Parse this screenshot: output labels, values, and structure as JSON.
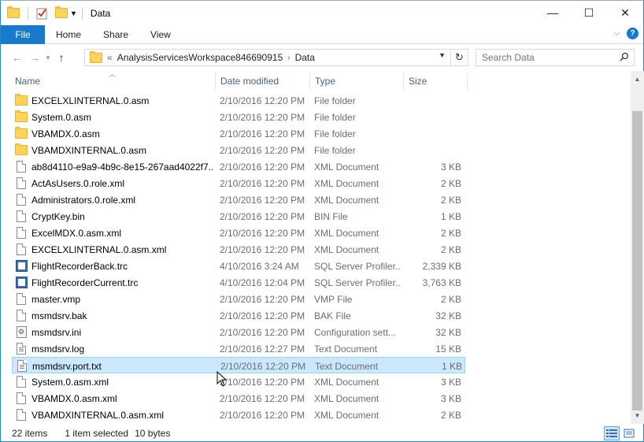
{
  "window": {
    "title": "Data",
    "controls": {
      "minimize": "—",
      "maximize": "☐",
      "close": "✕"
    }
  },
  "ribbon": {
    "tabs": [
      "File",
      "Home",
      "Share",
      "View"
    ]
  },
  "address": {
    "overflow": "«",
    "crumbs": [
      "AnalysisServicesWorkspace846690915",
      "Data"
    ]
  },
  "search": {
    "placeholder": "Search Data"
  },
  "columns": {
    "name": "Name",
    "date": "Date modified",
    "type": "Type",
    "size": "Size"
  },
  "files": [
    {
      "icon": "folder-icon",
      "name": "EXCELXLINTERNAL.0.asm",
      "date": "2/10/2016 12:20 PM",
      "type": "File folder",
      "size": ""
    },
    {
      "icon": "folder-icon",
      "name": "System.0.asm",
      "date": "2/10/2016 12:20 PM",
      "type": "File folder",
      "size": ""
    },
    {
      "icon": "folder-icon",
      "name": "VBAMDX.0.asm",
      "date": "2/10/2016 12:20 PM",
      "type": "File folder",
      "size": ""
    },
    {
      "icon": "folder-icon",
      "name": "VBAMDXINTERNAL.0.asm",
      "date": "2/10/2016 12:20 PM",
      "type": "File folder",
      "size": ""
    },
    {
      "icon": "document-icon",
      "name": "ab8d4110-e9a9-4b9c-8e15-267aad4022f7....",
      "date": "2/10/2016 12:20 PM",
      "type": "XML Document",
      "size": "3 KB"
    },
    {
      "icon": "document-icon",
      "name": "ActAsUsers.0.role.xml",
      "date": "2/10/2016 12:20 PM",
      "type": "XML Document",
      "size": "2 KB"
    },
    {
      "icon": "document-icon",
      "name": "Administrators.0.role.xml",
      "date": "2/10/2016 12:20 PM",
      "type": "XML Document",
      "size": "2 KB"
    },
    {
      "icon": "document-icon",
      "name": "CryptKey.bin",
      "date": "2/10/2016 12:20 PM",
      "type": "BIN File",
      "size": "1 KB"
    },
    {
      "icon": "document-icon",
      "name": "ExcelMDX.0.asm.xml",
      "date": "2/10/2016 12:20 PM",
      "type": "XML Document",
      "size": "2 KB"
    },
    {
      "icon": "document-icon",
      "name": "EXCELXLINTERNAL.0.asm.xml",
      "date": "2/10/2016 12:20 PM",
      "type": "XML Document",
      "size": "2 KB"
    },
    {
      "icon": "trace-file-icon",
      "name": "FlightRecorderBack.trc",
      "date": "4/10/2016 3:24 AM",
      "type": "SQL Server Profiler...",
      "size": "2,339 KB"
    },
    {
      "icon": "trace-file-icon",
      "name": "FlightRecorderCurrent.trc",
      "date": "4/10/2016 12:04 PM",
      "type": "SQL Server Profiler...",
      "size": "3,763 KB"
    },
    {
      "icon": "document-icon",
      "name": "master.vmp",
      "date": "2/10/2016 12:20 PM",
      "type": "VMP File",
      "size": "2 KB"
    },
    {
      "icon": "document-icon",
      "name": "msmdsrv.bak",
      "date": "2/10/2016 12:20 PM",
      "type": "BAK File",
      "size": "32 KB"
    },
    {
      "icon": "settings-file-icon",
      "name": "msmdsrv.ini",
      "date": "2/10/2016 12:20 PM",
      "type": "Configuration sett...",
      "size": "32 KB"
    },
    {
      "icon": "text-file-icon",
      "name": "msmdsrv.log",
      "date": "2/10/2016 12:27 PM",
      "type": "Text Document",
      "size": "15 KB"
    },
    {
      "icon": "text-file-icon",
      "name": "msmdsrv.port.txt",
      "date": "2/10/2016 12:20 PM",
      "type": "Text Document",
      "size": "1 KB",
      "selected": true
    },
    {
      "icon": "document-icon",
      "name": "System.0.asm.xml",
      "date": "2/10/2016 12:20 PM",
      "type": "XML Document",
      "size": "3 KB"
    },
    {
      "icon": "document-icon",
      "name": "VBAMDX.0.asm.xml",
      "date": "2/10/2016 12:20 PM",
      "type": "XML Document",
      "size": "3 KB"
    },
    {
      "icon": "document-icon",
      "name": "VBAMDXINTERNAL.0.asm.xml",
      "date": "2/10/2016 12:20 PM",
      "type": "XML Document",
      "size": "2 KB"
    }
  ],
  "status": {
    "count": "22 items",
    "selection": "1 item selected",
    "size": "10 bytes"
  },
  "colors": {
    "accent": "#1979ca",
    "selection": "#cce8ff",
    "selection_border": "#99d1ff"
  }
}
